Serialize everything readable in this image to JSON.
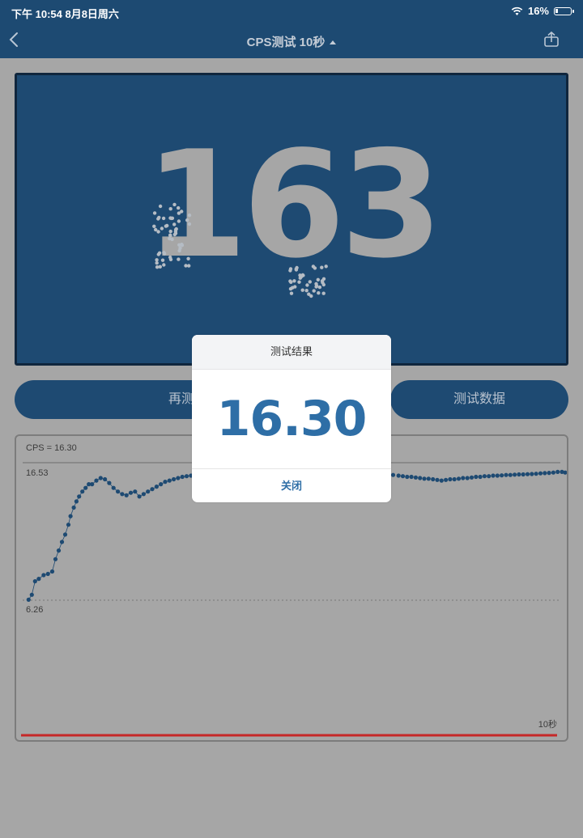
{
  "status_bar": {
    "time": "下午 10:54   8月8日周六",
    "battery": "16%"
  },
  "nav": {
    "title": "CPS测试 10秒"
  },
  "click_area": {
    "count": "163"
  },
  "buttons": {
    "retest": "再测",
    "test_data": "测试数据"
  },
  "chart": {
    "cps_label": "CPS = 16.30",
    "max_label": "16.53",
    "min_label": "6.26",
    "x_end_label": "10秒"
  },
  "chart_data": {
    "type": "scatter",
    "title": "",
    "xlabel": "",
    "ylabel": "",
    "xlim": [
      0,
      10
    ],
    "ylim": [
      4.6,
      16.53
    ],
    "reference_lines": [
      {
        "label": "16.53",
        "y": 16.53,
        "style": "solid"
      },
      {
        "label": "6.26",
        "y": 6.26,
        "style": "dotted"
      }
    ],
    "series": [
      {
        "x": [
          0.02,
          0.08,
          0.14,
          0.21,
          0.3,
          0.38,
          0.46,
          0.52,
          0.58,
          0.64,
          0.7,
          0.76,
          0.8,
          0.86,
          0.91,
          0.96,
          1.02,
          1.08,
          1.14,
          1.2,
          1.28,
          1.36,
          1.44,
          1.52,
          1.6,
          1.68,
          1.76,
          1.84,
          1.92,
          2.0,
          2.08,
          2.16,
          2.24,
          2.32,
          2.4,
          2.48,
          2.56,
          2.64,
          2.72,
          2.8,
          2.88,
          2.96,
          3.04,
          3.12,
          6.8,
          6.9,
          6.98,
          7.06,
          7.14,
          7.22,
          7.3,
          7.38,
          7.46,
          7.54,
          7.62,
          7.7,
          7.78,
          7.86,
          7.94,
          8.02,
          8.1,
          8.18,
          8.26,
          8.34,
          8.42,
          8.5,
          8.58,
          8.66,
          8.74,
          8.82,
          8.9,
          8.98,
          9.06,
          9.14,
          9.22,
          9.3,
          9.38,
          9.46,
          9.54,
          9.62,
          9.7,
          9.78,
          9.86,
          9.94,
          10.0
        ],
        "y": [
          6.3,
          6.7,
          7.8,
          8.0,
          8.3,
          8.4,
          8.6,
          9.6,
          10.3,
          11.0,
          11.6,
          12.4,
          13.1,
          13.8,
          14.3,
          14.7,
          15.1,
          15.4,
          15.7,
          15.7,
          16.0,
          16.2,
          16.1,
          15.8,
          15.4,
          15.1,
          14.9,
          14.8,
          15.0,
          15.1,
          14.7,
          14.9,
          15.1,
          15.3,
          15.5,
          15.7,
          15.9,
          16.0,
          16.1,
          16.2,
          16.3,
          16.35,
          16.4,
          16.45,
          16.45,
          16.4,
          16.35,
          16.3,
          16.3,
          16.25,
          16.2,
          16.15,
          16.15,
          16.1,
          16.05,
          16.0,
          16.05,
          16.1,
          16.1,
          16.15,
          16.2,
          16.2,
          16.25,
          16.3,
          16.3,
          16.35,
          16.35,
          16.4,
          16.4,
          16.42,
          16.45,
          16.45,
          16.48,
          16.5,
          16.5,
          16.52,
          16.53,
          16.55,
          16.58,
          16.6,
          16.62,
          16.65,
          16.7,
          16.7,
          16.65
        ]
      }
    ]
  },
  "modal": {
    "title": "测试结果",
    "value": "16.30",
    "close_label": "关闭"
  },
  "colors": {
    "nav_bg": "#1d4a72",
    "overlay_bg": "#a6a6a6",
    "accent": "#2e6ea6",
    "baseline": "#c62828",
    "point": "#1e4a72"
  },
  "icons": {
    "back": "chevron-left-icon",
    "share": "share-icon",
    "wifi": "wifi-icon",
    "battery": "battery-icon"
  }
}
